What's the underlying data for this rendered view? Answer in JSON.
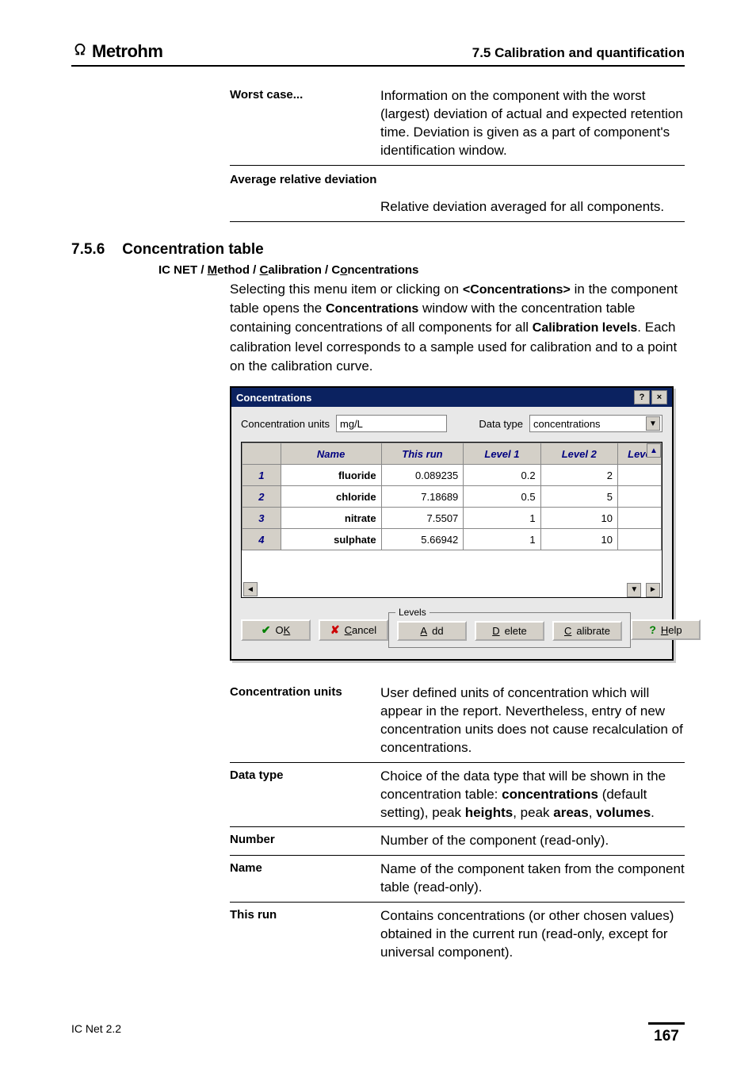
{
  "header": {
    "logo": "Metrohm",
    "section_ref": "7.5  Calibration and quantification"
  },
  "defs_top": [
    {
      "term": "Worst case...",
      "desc": "Information on the component with the worst (largest) deviation of actual and expected retention time. Deviation is given as a part of component's identification window."
    },
    {
      "term": "Average relative deviation",
      "desc": "Relative deviation averaged for all components."
    }
  ],
  "section": {
    "num": "7.5.6",
    "title": "Concentration table",
    "breadcrumb_plain": "IC NET / Method / Calibration / Concentrations",
    "para_prefix": "Selecting this menu item or clicking on ",
    "para_tag": "<Concentrations>",
    "para_mid1": " in the component table opens the ",
    "para_bold1": "Concentrations",
    "para_mid2": " window with the concentration table containing concentrations of all components for all ",
    "para_bold2": "Calibration levels",
    "para_suffix": ". Each calibration level corresponds to a sample used for calibration and to a point on the calibration curve."
  },
  "dialog": {
    "title": "Concentrations",
    "units_label": "Concentration units",
    "units_value": "mg/L",
    "datatype_label": "Data type",
    "datatype_value": "concentrations",
    "columns": [
      "",
      "Name",
      "This run",
      "Level 1",
      "Level 2",
      "Leve"
    ],
    "rows": [
      {
        "n": "1",
        "name": "fluoride",
        "thisrun": "0.089235",
        "l1": "0.2",
        "l2": "2"
      },
      {
        "n": "2",
        "name": "chloride",
        "thisrun": "7.18689",
        "l1": "0.5",
        "l2": "5"
      },
      {
        "n": "3",
        "name": "nitrate",
        "thisrun": "7.5507",
        "l1": "1",
        "l2": "10"
      },
      {
        "n": "4",
        "name": "sulphate",
        "thisrun": "5.66942",
        "l1": "1",
        "l2": "10"
      }
    ],
    "buttons": {
      "ok": "OK",
      "cancel": "Cancel",
      "add": "Add",
      "delete": "Delete",
      "calibrate": "Calibrate",
      "help": "Help",
      "levels_legend": "Levels"
    }
  },
  "defs_after": [
    {
      "term": "Concentration units",
      "desc": "User defined units of concentration which will appear in the report. Nevertheless, entry of new concentration units does not cause recalculation of concentrations."
    },
    {
      "term": "Data type",
      "desc_prefix": "Choice of the data type that will be shown in the concentration table: ",
      "b1": "concentrations",
      "mid1": " (default setting), peak ",
      "b2": "heights",
      "mid2": ", peak ",
      "b3": "areas",
      "mid3": ", ",
      "b4": "volumes",
      "suffix": "."
    },
    {
      "term": "Number",
      "desc": "Number of the component (read-only)."
    },
    {
      "term": "Name",
      "desc": "Name of the component taken from the component table (read-only)."
    },
    {
      "term": "This run",
      "desc": "Contains concentrations (or other chosen values) obtained in the current run (read-only, except for universal component)."
    }
  ],
  "footer": {
    "left": "IC Net 2.2",
    "page": "167"
  },
  "chart_data": {
    "type": "table",
    "columns": [
      "Name",
      "This run",
      "Level 1",
      "Level 2"
    ],
    "rows": [
      [
        "fluoride",
        0.089235,
        0.2,
        2
      ],
      [
        "chloride",
        7.18689,
        0.5,
        5
      ],
      [
        "nitrate",
        7.5507,
        1,
        10
      ],
      [
        "sulphate",
        5.66942,
        1,
        10
      ]
    ]
  }
}
